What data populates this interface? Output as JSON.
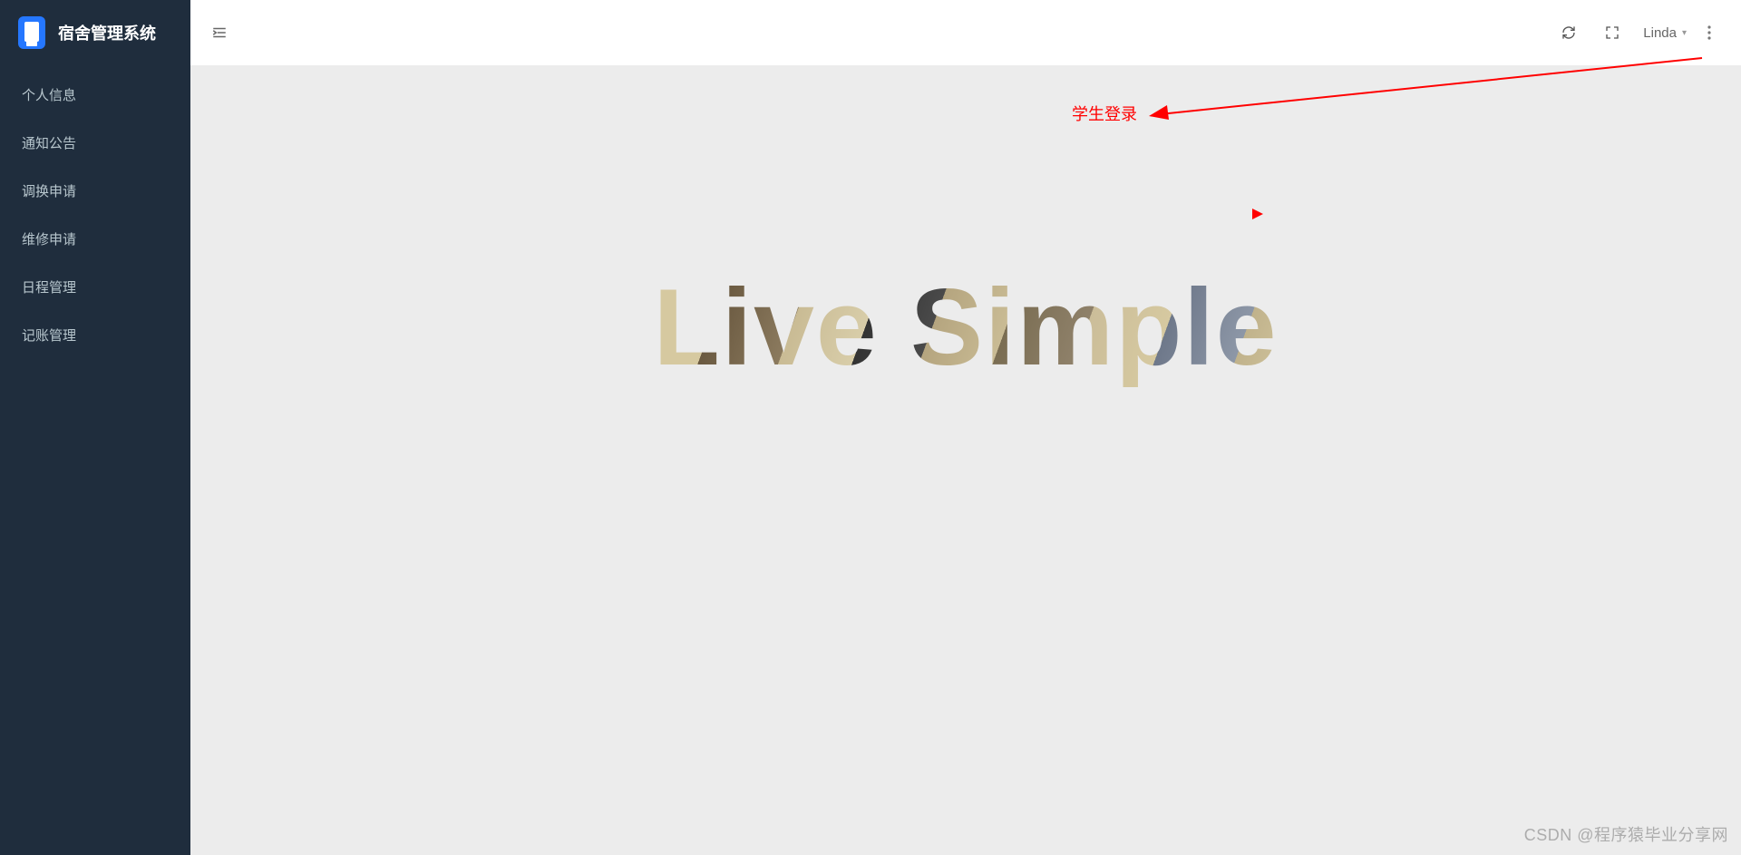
{
  "app": {
    "title": "宿舍管理系统"
  },
  "sidebar": {
    "items": [
      {
        "label": "个人信息"
      },
      {
        "label": "通知公告"
      },
      {
        "label": "调换申请"
      },
      {
        "label": "维修申请"
      },
      {
        "label": "日程管理"
      },
      {
        "label": "记账管理"
      }
    ]
  },
  "topbar": {
    "username": "Linda"
  },
  "main": {
    "hero_text": "Live Simple"
  },
  "annotation": {
    "label": "学生登录"
  },
  "watermark": "CSDN @程序猿毕业分享网"
}
